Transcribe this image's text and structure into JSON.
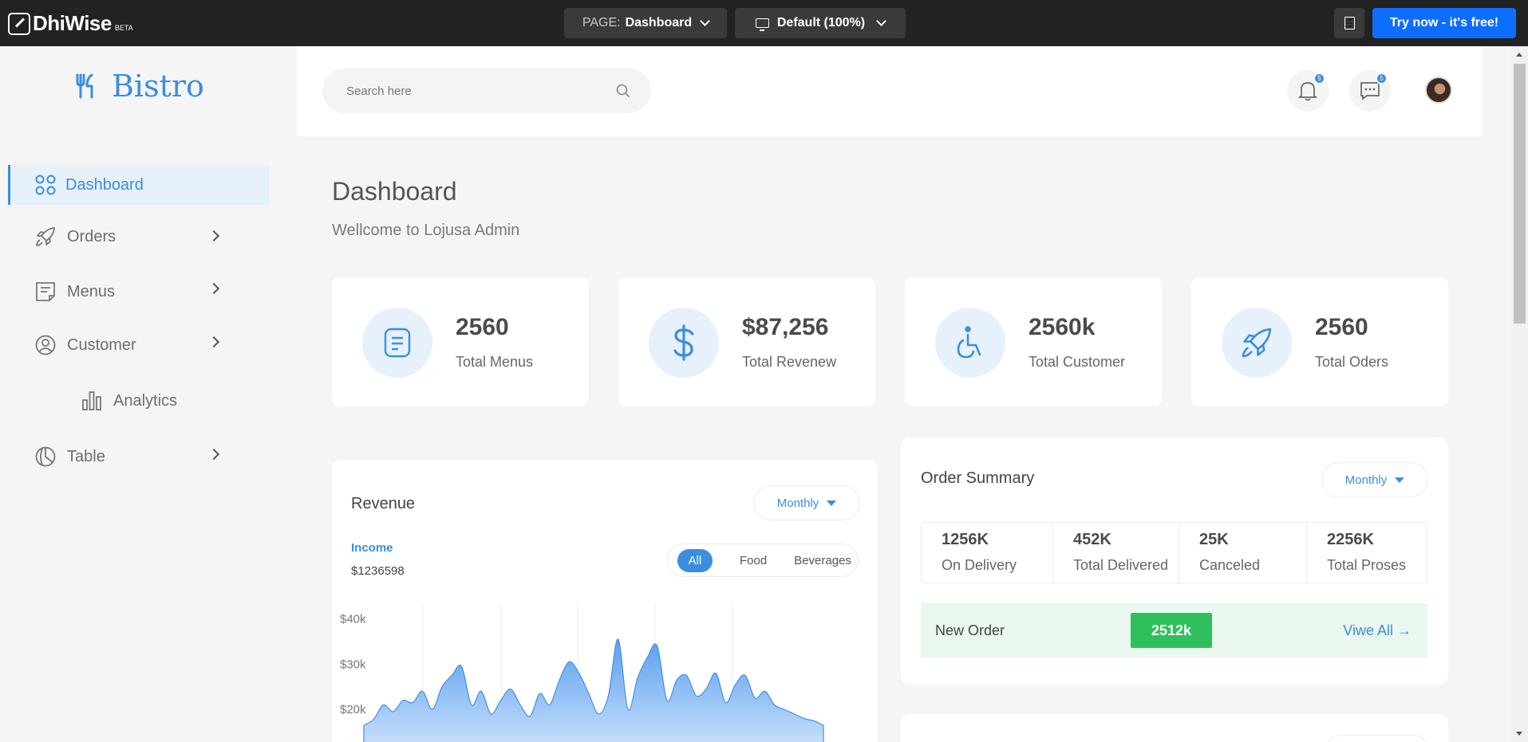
{
  "topbar": {
    "logo_text": "DhiWise",
    "beta": "BETA",
    "page_label": "PAGE:",
    "page_value": "Dashboard",
    "view_value": "Default (100%)",
    "try_label": "Try now - it's free!"
  },
  "sidebar": {
    "brand": "Bistro",
    "items": [
      {
        "label": "Dashboard",
        "icon": "grid-icon",
        "active": true,
        "arrow": false
      },
      {
        "label": "Orders",
        "icon": "rocket-icon",
        "active": false,
        "arrow": true
      },
      {
        "label": "Menus",
        "icon": "note-icon",
        "active": false,
        "arrow": true
      },
      {
        "label": "Customer",
        "icon": "user-circle-icon",
        "active": false,
        "arrow": true
      },
      {
        "label": "Analytics",
        "icon": "bar-chart-icon",
        "active": false,
        "arrow": false
      },
      {
        "label": "Table",
        "icon": "pie-icon",
        "active": false,
        "arrow": true
      }
    ]
  },
  "header": {
    "search_placeholder": "Search here",
    "notifications_count": "5",
    "messages_count": "5"
  },
  "page": {
    "title": "Dashboard",
    "subtitle": "Wellcome to Lojusa Admin"
  },
  "stats": [
    {
      "value": "2560",
      "label": "Total Menus",
      "icon": "menu-list-icon"
    },
    {
      "value": "$87,256",
      "label": "Total Revenew",
      "icon": "dollar-icon"
    },
    {
      "value": "2560k",
      "label": "Total Customer",
      "icon": "wheelchair-icon"
    },
    {
      "value": "2560",
      "label": "Total Oders",
      "icon": "rocket-icon"
    }
  ],
  "revenue": {
    "title": "Revenue",
    "period": "Monthly",
    "income_label": "Income",
    "income_value": "$1236598",
    "filters": [
      "All",
      "Food",
      "Beverages"
    ],
    "active_filter": "All"
  },
  "chart_data": {
    "type": "area",
    "title": "",
    "ylabel": "",
    "xlabel": "",
    "y_ticks": [
      "$40k",
      "$30k",
      "$20k"
    ],
    "ylim": [
      10000,
      42000
    ],
    "grid": true,
    "series": [
      {
        "values": [
          16500,
          17800,
          21000,
          19500,
          22000,
          21500,
          24000,
          20000,
          25000,
          27500,
          29500,
          21000,
          24000,
          19000,
          22000,
          24500,
          21000,
          18500,
          23500,
          21000,
          26500,
          30500,
          28000,
          23500,
          19000,
          23000,
          35500,
          20000,
          27000,
          31500,
          34000,
          22000,
          26500,
          27500,
          23000,
          24500,
          28000,
          21500,
          25500,
          27500,
          22500,
          24000,
          21000,
          20000,
          19000,
          18000,
          17500,
          16500
        ]
      }
    ],
    "color": "#3b8ede"
  },
  "orders": {
    "title": "Order Summary",
    "period": "Monthly",
    "summary": [
      {
        "value": "1256K",
        "label": "On Delivery"
      },
      {
        "value": "452K",
        "label": "Total Delivered"
      },
      {
        "value": "25K",
        "label": "Canceled"
      },
      {
        "value": "2256K",
        "label": "Total Proses"
      }
    ],
    "new_order_label": "New Order",
    "new_order_count": "2512k",
    "view_all": "Viwe All →"
  },
  "colors": {
    "accent": "#3b8ede",
    "success": "#2ec05c",
    "cta": "#0d6efd"
  }
}
